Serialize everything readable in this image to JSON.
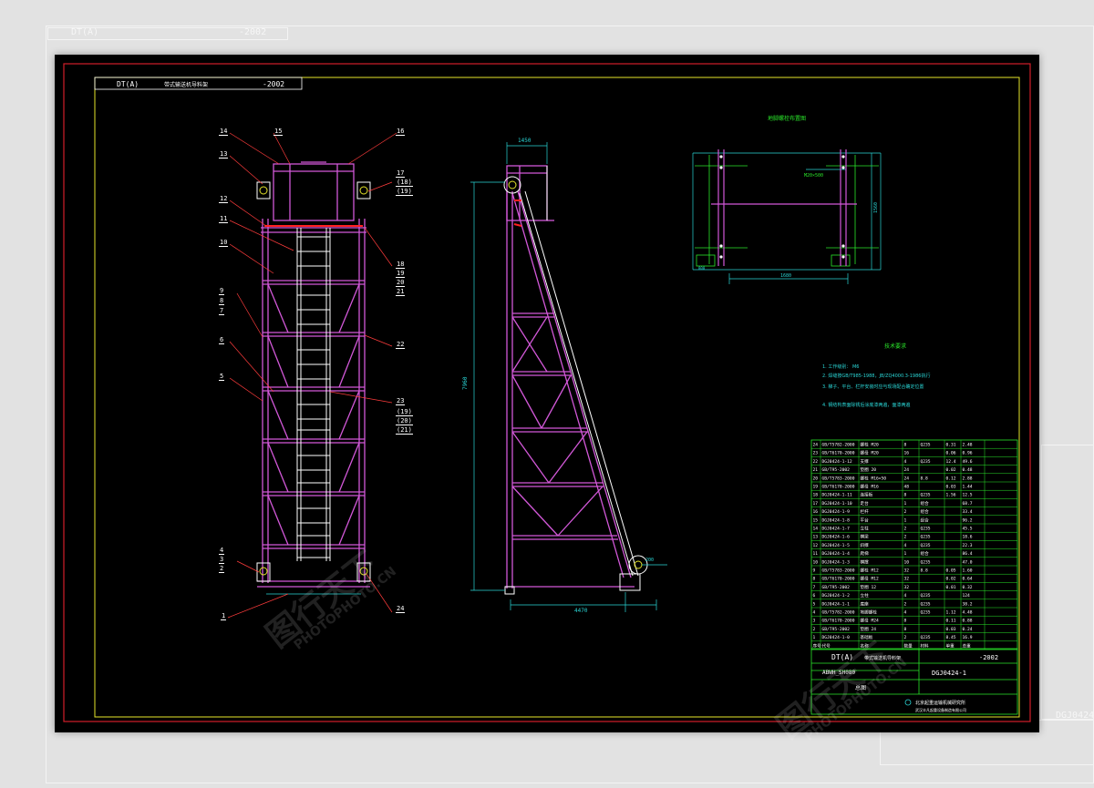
{
  "title_block": {
    "standard": "DT(A)",
    "title": "带式输送机导料架",
    "year": "-2002",
    "model": "ABWH_SH080",
    "drawing_no": "DGJ0424-1",
    "sheet": "总图",
    "company_1": "北京起重运输机械研究所",
    "company_2": "武汉丰凡起重设备制造有限公司"
  },
  "views": {
    "plan_title": "地脚螺栓布置图",
    "notes_title": "技术要求",
    "notes": [
      "1. 工作级别：   M6",
      "2. 焊缝按GB/T985-1988，JB/ZQ4000.3-1986执行",
      "3. 梯子、平台、栏杆安装时应与现场配合确定位置",
      "4. 钢结构表面除锈后涂底漆两遍，面漆两遍"
    ],
    "bolt_label": "M20×500"
  },
  "dimensions": {
    "top_width": "1450",
    "side_height": "7960",
    "base_len": "4470",
    "plan_width": "1680",
    "plan_height": "1560",
    "small_dim_1": "200",
    "small_dim_2": "800"
  },
  "balloons": {
    "left": [
      "14",
      "13",
      "12",
      "11",
      "10",
      "9",
      "8",
      "7",
      "6",
      "5",
      "4",
      "3",
      "2",
      "1"
    ],
    "right": [
      "15",
      "16",
      "17",
      "(18)",
      "(19)",
      "18",
      "19",
      "20",
      "21",
      "22",
      "23",
      "(19)",
      "(20)",
      "(21)",
      "24"
    ]
  },
  "bom": {
    "rows": [
      [
        "24",
        "GB/T5782-2000",
        "螺栓 M20",
        "8",
        "Q235",
        "0.31",
        "2.48"
      ],
      [
        "23",
        "GB/T6170-2000",
        "螺母 M20",
        "16",
        "",
        "0.06",
        "0.96"
      ],
      [
        "22",
        "DGJ0424-1-12",
        "支撑",
        "4",
        "Q235",
        "12.4",
        "49.6"
      ],
      [
        "21",
        "GB/T95-2002",
        "垫圈 20",
        "24",
        "",
        "0.02",
        "0.48"
      ],
      [
        "20",
        "GB/T5783-2000",
        "螺栓 M16×50",
        "24",
        "8.8",
        "0.12",
        "2.88"
      ],
      [
        "19",
        "GB/T6170-2000",
        "螺母 M16",
        "48",
        "",
        "0.03",
        "1.44"
      ],
      [
        "18",
        "DGJ0424-1-11",
        "连接板",
        "8",
        "Q235",
        "1.56",
        "12.5"
      ],
      [
        "17",
        "DGJ0424-1-10",
        "走台",
        "1",
        "组合",
        "",
        "68.7"
      ],
      [
        "16",
        "DGJ0424-1-9",
        "栏杆",
        "2",
        "组合",
        "",
        "33.4"
      ],
      [
        "15",
        "DGJ0424-1-8",
        "平台",
        "1",
        "组合",
        "",
        "96.2"
      ],
      [
        "14",
        "DGJ0424-1-7",
        "立柱",
        "2",
        "Q235",
        "",
        "45.5"
      ],
      [
        "13",
        "DGJ0424-1-6",
        "横梁",
        "2",
        "Q235",
        "",
        "18.6"
      ],
      [
        "12",
        "DGJ0424-1-5",
        "斜撑",
        "4",
        "Q235",
        "",
        "22.3"
      ],
      [
        "11",
        "DGJ0424-1-4",
        "爬梯",
        "1",
        "组合",
        "",
        "86.4"
      ],
      [
        "10",
        "DGJ0424-1-3",
        "横撑",
        "10",
        "Q235",
        "",
        "47.0"
      ],
      [
        "9",
        "GB/T5783-2000",
        "螺栓 M12",
        "32",
        "8.8",
        "0.05",
        "1.60"
      ],
      [
        "8",
        "GB/T6170-2000",
        "螺母 M12",
        "32",
        "",
        "0.02",
        "0.64"
      ],
      [
        "7",
        "GB/T95-2002",
        "垫圈 12",
        "32",
        "",
        "0.01",
        "0.32"
      ],
      [
        "6",
        "DGJ0424-1-2",
        "立柱",
        "4",
        "Q235",
        "",
        "124"
      ],
      [
        "5",
        "DGJ0424-1-1",
        "底座",
        "2",
        "Q235",
        "",
        "38.2"
      ],
      [
        "4",
        "GB/T5782-2000",
        "地脚螺栓",
        "4",
        "Q235",
        "1.12",
        "4.48"
      ],
      [
        "3",
        "GB/T6170-2000",
        "螺母 M24",
        "8",
        "",
        "0.11",
        "0.88"
      ],
      [
        "2",
        "GB/T95-2002",
        "垫圈 24",
        "8",
        "",
        "0.03",
        "0.24"
      ],
      [
        "1",
        "DGJ0424-1-0",
        "基础板",
        "2",
        "Q235",
        "8.45",
        "16.9"
      ]
    ],
    "header": [
      "序号",
      "代号",
      "名称",
      "数量",
      "材料",
      "单重",
      "总重"
    ]
  },
  "watermark": {
    "cn": "图行天下",
    "en": "PHOTOPHOTO.CN"
  },
  "colors": {
    "canvas": "#000000",
    "frame_outer": "#d21f2a",
    "frame_inner": "#e6e62a",
    "structure": "#d258d8",
    "ladder": "#ffffff",
    "leader": "#ff3c3c",
    "label": "#2ae62a",
    "dim": "#2ad6d6",
    "table": "#2ae62a",
    "red_accent": "#ff2020"
  }
}
